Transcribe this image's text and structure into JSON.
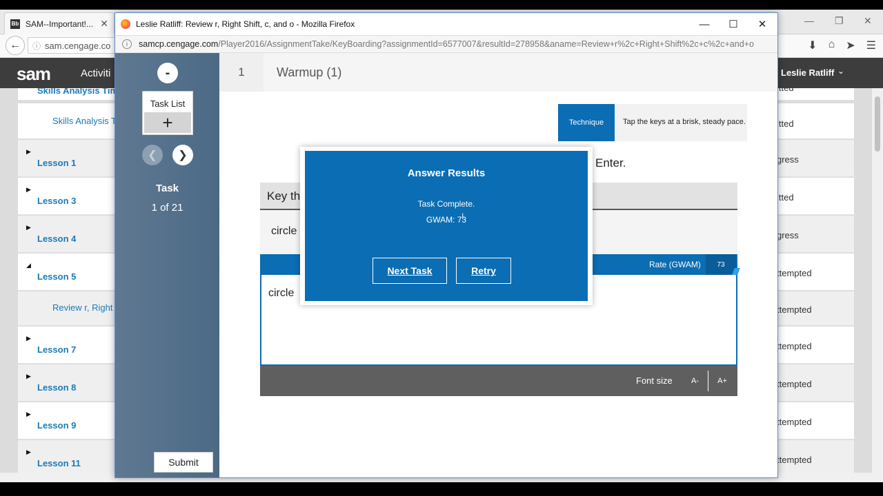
{
  "background_browser": {
    "tab_title": "SAM--Important!...",
    "tab_icon": "Bb",
    "address": "sam.cengage.co",
    "sam_logo": "sam",
    "nav_activities": "Activiti",
    "user_name": "Leslie Ratliff",
    "rows": [
      {
        "lesson": "Skills Analysis Tim",
        "status": "itted"
      },
      {
        "sub": "Skills Analysis T",
        "status": "itted"
      },
      {
        "lesson": "Lesson 1",
        "status": "gress"
      },
      {
        "lesson": "Lesson 3",
        "status": "itted"
      },
      {
        "lesson": "Lesson 4",
        "status": "gress"
      },
      {
        "lesson": "Lesson 5",
        "status": "ttempted"
      },
      {
        "sub": "Review r, Right S",
        "status": "ttempted"
      },
      {
        "lesson": "Lesson 7",
        "status": "ttempted"
      },
      {
        "lesson": "Lesson 8",
        "status": "ttempted"
      },
      {
        "lesson": "Lesson 9",
        "status": "ttempted"
      },
      {
        "lesson": "Lesson 11",
        "status": "ttempted"
      }
    ]
  },
  "popup": {
    "window_title": "Leslie Ratliff: Review r, Right Shift, c, and o - Mozilla Firefox",
    "url_host": "samcp.cengage.com",
    "url_path": "/Player2016/AssignmentTake/KeyBoarding?assignmentId=6577007&resultId=278958&aname=Review+r%2c+Right+Shift%2c+c%2c+and+o",
    "collapse_label": "-",
    "task_list_label": "Task List",
    "task_list_add": "+",
    "task_label": "Task",
    "task_count": "1 of 21",
    "submit_label": "Submit",
    "step_number": "1",
    "step_title": "Warmup (1)",
    "technique_label": "Technique",
    "technique_text": "Tap the keys at a brisk, steady pace.",
    "instruction_tail": "Enter.",
    "key_header": "Key th",
    "prompt_text": "circle",
    "rate_label": "Rate (GWAM)",
    "rate_value": "73",
    "typed_text": "circle",
    "font_size_label": "Font size",
    "font_decrease": "A-",
    "font_increase": "A+"
  },
  "modal": {
    "title": "Answer Results",
    "message": "Task Complete.",
    "gwam": "GWAM: 73",
    "next_label": "Next Task",
    "retry_label": "Retry"
  },
  "colors": {
    "accent_blue": "#0b6db3",
    "panel_slate": "#4b6a86",
    "header_dark": "#3d3d3d",
    "link_blue": "#1a7ab8"
  }
}
